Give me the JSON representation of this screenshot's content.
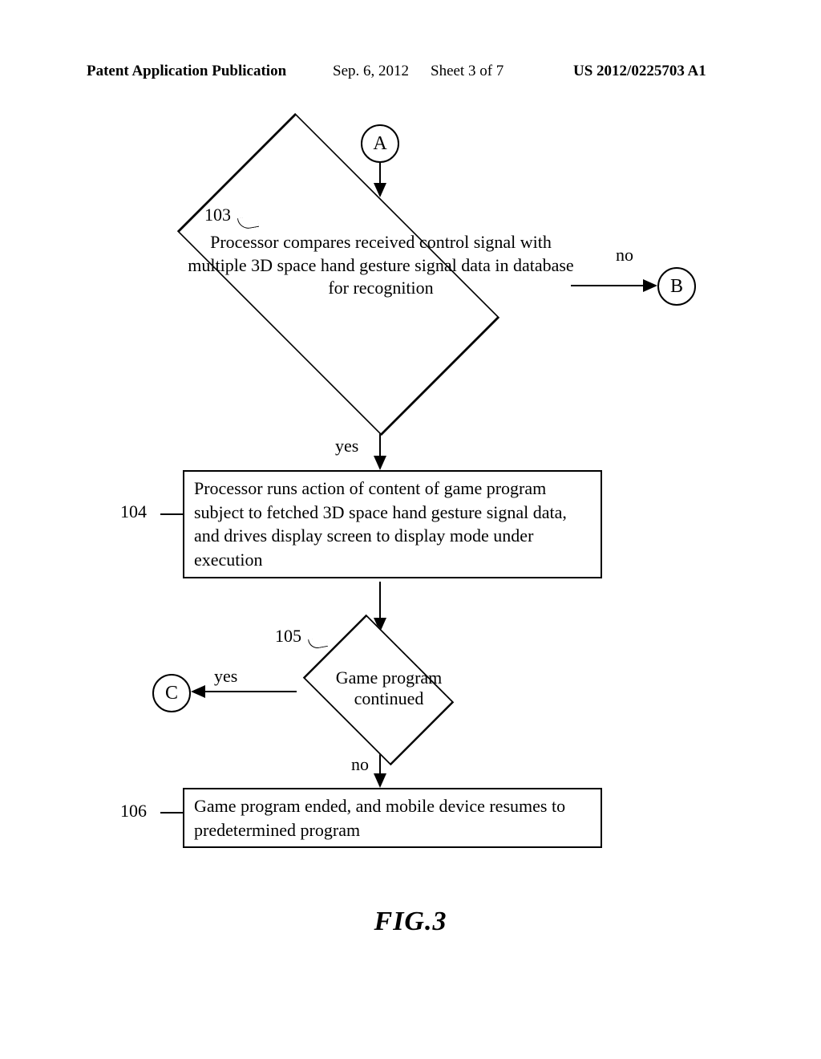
{
  "header": {
    "pubtype": "Patent Application Publication",
    "date": "Sep. 6, 2012",
    "sheet": "Sheet 3 of 7",
    "pubnum": "US 2012/0225703 A1"
  },
  "connectors": {
    "a": "A",
    "b": "B",
    "c": "C"
  },
  "labels": {
    "ref103": "103",
    "ref104": "104",
    "ref105": "105",
    "ref106": "106",
    "no1": "no",
    "yes1": "yes",
    "yes2": "yes",
    "no2": "no"
  },
  "blocks": {
    "d103": "Processor compares received control signal with multiple 3D space hand gesture signal data in database for recognition",
    "b104": "Processor runs action of content of game program subject to fetched 3D space hand gesture signal data, and drives display screen to display mode under execution",
    "d105": "Game program continued",
    "b106": "Game program ended, and mobile device resumes to predetermined program"
  },
  "figure_caption": "FIG.3",
  "chart_data": {
    "type": "flowchart",
    "nodes": [
      {
        "id": "A",
        "kind": "connector",
        "label": "A"
      },
      {
        "id": "103",
        "kind": "decision",
        "label": "Processor compares received control signal with multiple 3D space hand gesture signal data in database for recognition"
      },
      {
        "id": "B",
        "kind": "connector",
        "label": "B"
      },
      {
        "id": "104",
        "kind": "process",
        "label": "Processor runs action of content of game program subject to fetched 3D space hand gesture signal data, and drives display screen to display mode under execution"
      },
      {
        "id": "105",
        "kind": "decision",
        "label": "Game program continued"
      },
      {
        "id": "C",
        "kind": "connector",
        "label": "C"
      },
      {
        "id": "106",
        "kind": "process",
        "label": "Game program ended, and mobile device resumes to predetermined program"
      }
    ],
    "edges": [
      {
        "from": "A",
        "to": "103",
        "label": ""
      },
      {
        "from": "103",
        "to": "B",
        "label": "no"
      },
      {
        "from": "103",
        "to": "104",
        "label": "yes"
      },
      {
        "from": "104",
        "to": "105",
        "label": ""
      },
      {
        "from": "105",
        "to": "C",
        "label": "yes"
      },
      {
        "from": "105",
        "to": "106",
        "label": "no"
      },
      {
        "from": "C",
        "to": "A",
        "label": "",
        "offpage": true
      },
      {
        "from": "B",
        "to": "A",
        "label": "",
        "offpage": true
      }
    ],
    "title": "FIG.3"
  }
}
